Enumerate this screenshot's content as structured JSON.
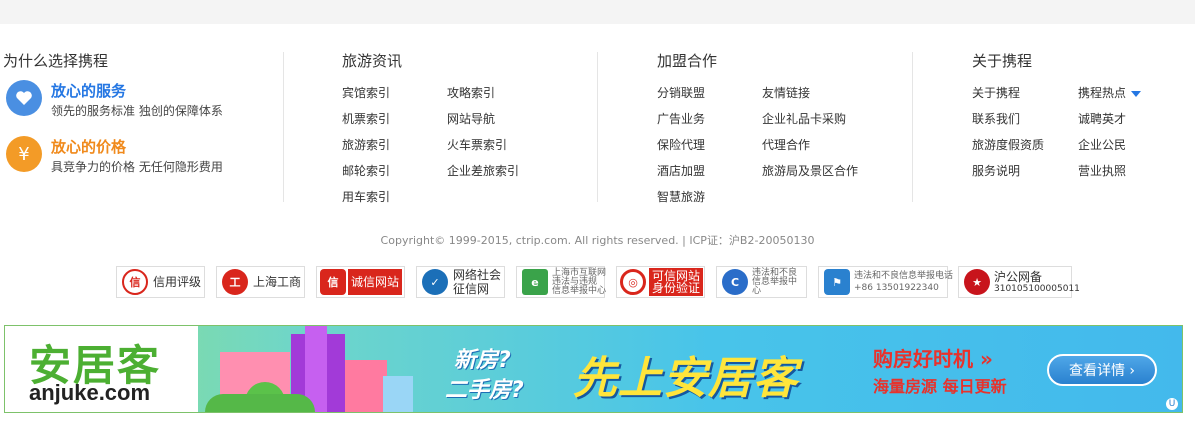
{
  "why": {
    "title": "为什么选择携程",
    "items": [
      {
        "title": "放心的服务",
        "desc": "领先的服务标准 独创的保障体系",
        "color": "#2577e3",
        "icon_bg": "#4a8fe2",
        "icon": "heart-icon"
      },
      {
        "title": "放心的价格",
        "desc": "具竞争力的价格 无任何隐形费用",
        "color": "#f08a1c",
        "icon_bg": "#f39b27",
        "icon": "yen-icon",
        "icon_glyph": "¥"
      }
    ]
  },
  "travel": {
    "title": "旅游资讯",
    "links_left": [
      "宾馆索引",
      "机票索引",
      "旅游索引",
      "邮轮索引",
      "用车索引"
    ],
    "links_right": [
      "攻略索引",
      "网站导航",
      "火车票索引",
      "企业差旅索引"
    ]
  },
  "join": {
    "title": "加盟合作",
    "links_left": [
      "分销联盟",
      "广告业务",
      "保险代理",
      "酒店加盟",
      "智慧旅游"
    ],
    "links_right": [
      "友情链接",
      "企业礼品卡采购",
      "代理合作",
      "旅游局及景区合作"
    ]
  },
  "about": {
    "title": "关于携程",
    "links_left": [
      "关于携程",
      "联系我们",
      "旅游度假资质",
      "服务说明"
    ],
    "links_right": [
      "携程热点",
      "诚聘英才",
      "企业公民",
      "营业执照"
    ]
  },
  "copyright": "Copyright© 1999-2015, ctrip.com. All rights reserved. | ICP证：沪B2-20050130",
  "badges": [
    {
      "label": "信用评级",
      "icon": "credit-rating-icon",
      "color": "#d9261c",
      "glyph": "信"
    },
    {
      "label": "上海工商",
      "icon": "shanghai-aic-icon",
      "color": "#d9261c",
      "glyph": "工"
    },
    {
      "label": "诚信网站",
      "icon": "integrity-site-icon",
      "color": "#d9261c",
      "glyph": "信"
    },
    {
      "label": "网络社会征信网",
      "line1": "网络社会",
      "line2": "征信网",
      "icon": "credit-network-icon",
      "color": "#1b6fb8",
      "glyph": "✓"
    },
    {
      "label": "上海市互联网违法与违规信息举报中心",
      "line1": "上海市互联网",
      "line2": "违法与违规",
      "line3": "信息举报中心",
      "icon": "report-center-icon",
      "color": "#3aa34a",
      "glyph": "e"
    },
    {
      "label": "可信网站身份验证",
      "line1": "可信网站",
      "line2": "身份验证",
      "icon": "trusted-site-icon",
      "color": "#d9261c",
      "glyph": "◎"
    },
    {
      "label": "违法和不良信息举报中心",
      "line1": "违法和不良",
      "line2": "信息举报中",
      "line3": "心",
      "icon": "illegal-info-report-icon",
      "color": "#2a6dc9",
      "glyph": "C"
    },
    {
      "label": "违法和不良信息举报电话 +86 13501922340",
      "line1": "违法和不良信息举报电话",
      "line2": "+86 13501922340",
      "icon": "shield-icon",
      "color": "#2a81cf",
      "glyph": "⚑"
    },
    {
      "label": "沪公网备 310105100005011",
      "line1": "沪公网备",
      "line2": "310105100005011",
      "icon": "police-emblem-icon",
      "color": "#c8141c",
      "glyph": "★"
    }
  ],
  "ad": {
    "logo_cn": "安居客",
    "logo_en": "anjuke.com",
    "q1": "新房?",
    "q2": "二手房?",
    "headline": "先上安居客",
    "right1": "购房好时机 »",
    "right2": "海量房源 每日更新",
    "button": "查看详情 ›",
    "mark": "U"
  }
}
